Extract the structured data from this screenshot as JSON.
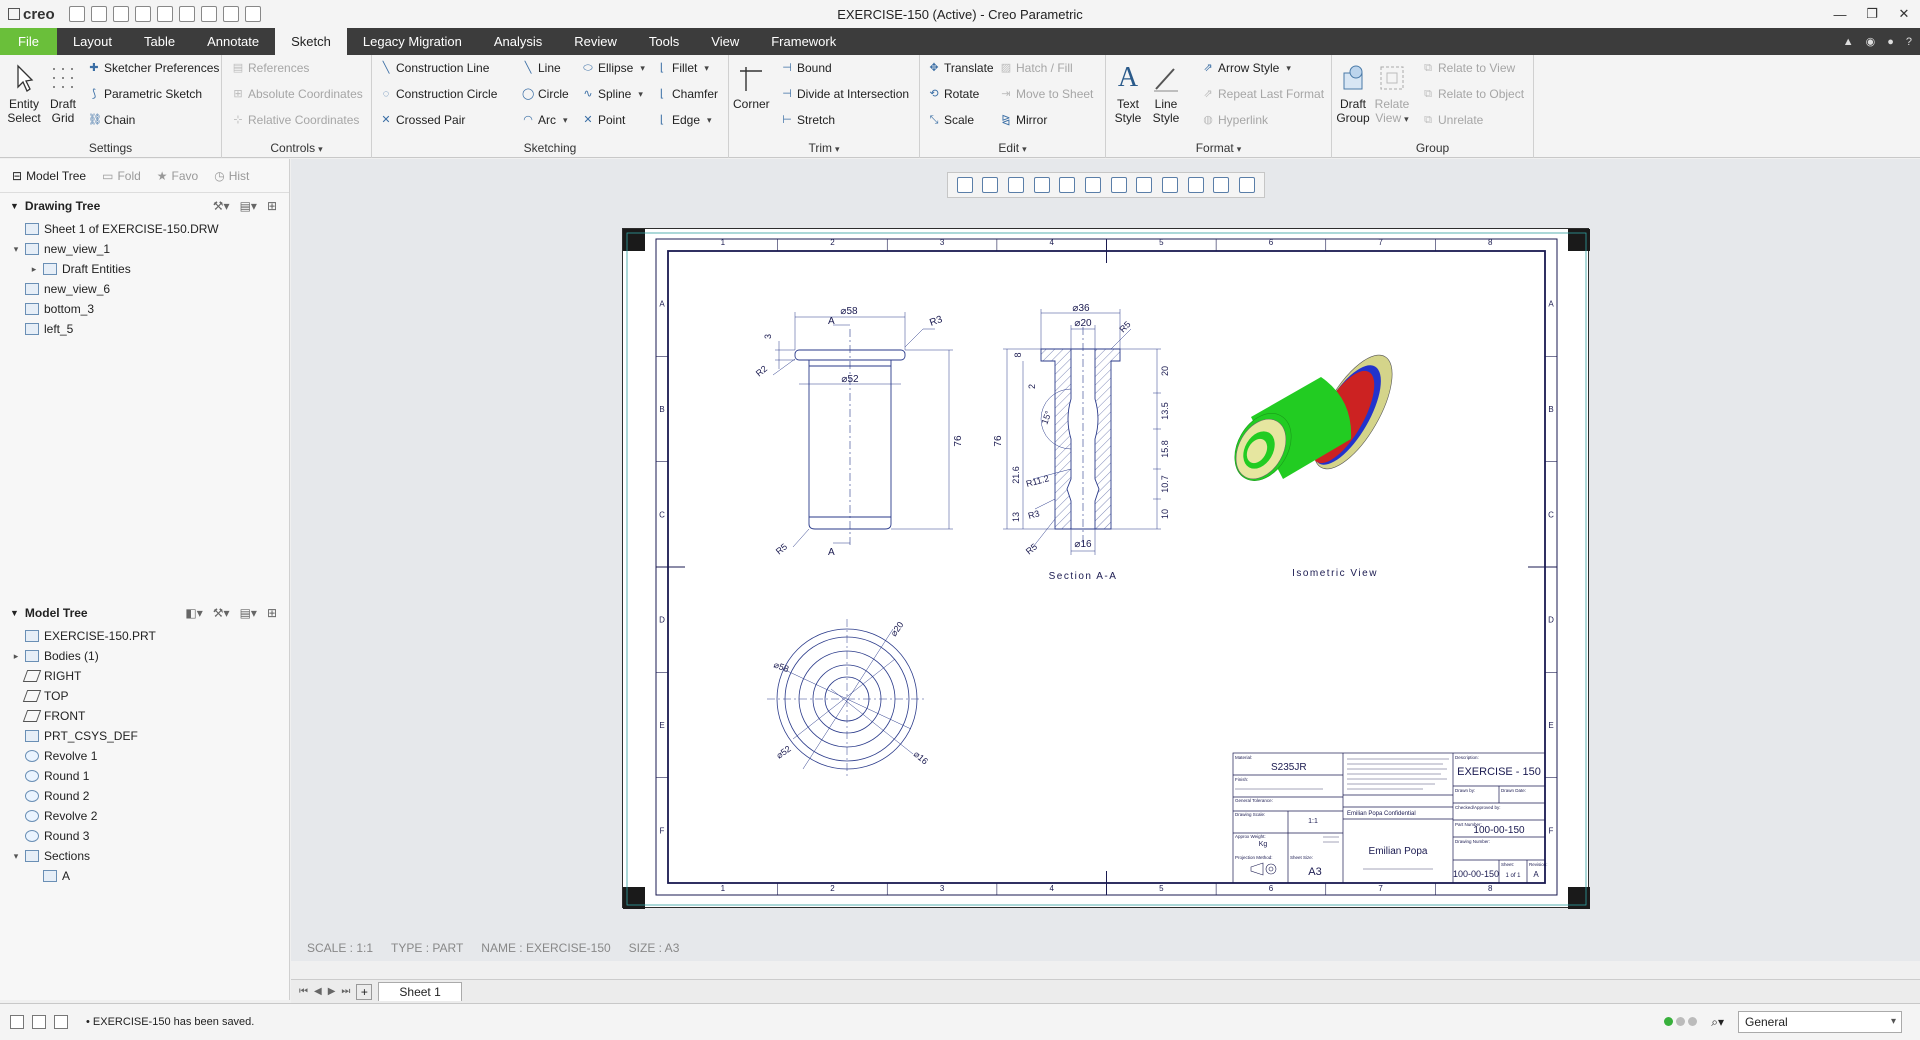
{
  "app": {
    "logo": "creo",
    "title": "EXERCISE-150 (Active) - Creo Parametric"
  },
  "tabs": [
    {
      "label": "File"
    },
    {
      "label": "Layout"
    },
    {
      "label": "Table"
    },
    {
      "label": "Annotate"
    },
    {
      "label": "Sketch"
    },
    {
      "label": "Legacy Migration"
    },
    {
      "label": "Analysis"
    },
    {
      "label": "Review"
    },
    {
      "label": "Tools"
    },
    {
      "label": "View"
    },
    {
      "label": "Framework"
    }
  ],
  "ribbon": {
    "settings": {
      "name": "Settings",
      "entity_select": "Entity Select",
      "draft_grid": "Draft Grid",
      "sketcher_preferences": "Sketcher Preferences",
      "parametric_sketch": "Parametric Sketch",
      "chain": "Chain"
    },
    "controls": {
      "name": "Controls",
      "references": "References",
      "absolute_coordinates": "Absolute Coordinates",
      "relative_coordinates": "Relative Coordinates"
    },
    "sketching": {
      "name": "Sketching",
      "construction_line": "Construction Line",
      "construction_circle": "Construction Circle",
      "crossed_pair": "Crossed Pair",
      "line": "Line",
      "circle": "Circle",
      "arc": "Arc",
      "ellipse": "Ellipse",
      "spline": "Spline",
      "point": "Point",
      "fillet": "Fillet",
      "chamfer": "Chamfer",
      "edge": "Edge"
    },
    "trim": {
      "name": "Trim",
      "corner": "Corner",
      "bound": "Bound",
      "divide_at_intersection": "Divide at Intersection",
      "stretch": "Stretch"
    },
    "edit": {
      "name": "Edit",
      "translate": "Translate",
      "rotate": "Rotate",
      "scale": "Scale",
      "hatch_fill": "Hatch / Fill",
      "move_to_sheet": "Move to Sheet",
      "mirror": "Mirror"
    },
    "format": {
      "name": "Format",
      "text_style": "Text Style",
      "line_style": "Line Style",
      "arrow_style": "Arrow Style",
      "repeat_last_format": "Repeat Last Format",
      "hyperlink": "Hyperlink"
    },
    "group": {
      "name": "Group",
      "draft_group": "Draft Group",
      "relate_view": "Relate View",
      "relate_to_view": "Relate to View",
      "relate_to_object": "Relate to Object",
      "unrelate": "Unrelate"
    }
  },
  "left_panel": {
    "tabs": [
      "Model Tree",
      "Fold",
      "Favo",
      "Hist"
    ],
    "drawing_tree": {
      "title": "Drawing Tree",
      "items": [
        {
          "label": "Sheet 1 of EXERCISE-150.DRW",
          "level": 0,
          "toggle": ""
        },
        {
          "label": "new_view_1",
          "level": 0,
          "toggle": "▾"
        },
        {
          "label": "Draft Entities",
          "level": 1,
          "toggle": "▸"
        },
        {
          "label": "new_view_6",
          "level": 0,
          "toggle": ""
        },
        {
          "label": "bottom_3",
          "level": 0,
          "toggle": ""
        },
        {
          "label": "left_5",
          "level": 0,
          "toggle": ""
        }
      ]
    },
    "model_tree": {
      "title": "Model Tree",
      "items": [
        {
          "label": "EXERCISE-150.PRT",
          "level": 0,
          "toggle": "",
          "kind": "part"
        },
        {
          "label": "Bodies (1)",
          "level": 0,
          "toggle": "▸",
          "kind": "part"
        },
        {
          "label": "RIGHT",
          "level": 0,
          "toggle": "",
          "kind": "plane"
        },
        {
          "label": "TOP",
          "level": 0,
          "toggle": "",
          "kind": "plane"
        },
        {
          "label": "FRONT",
          "level": 0,
          "toggle": "",
          "kind": "plane"
        },
        {
          "label": "PRT_CSYS_DEF",
          "level": 0,
          "toggle": "",
          "kind": "csys"
        },
        {
          "label": "Revolve 1",
          "level": 0,
          "toggle": "",
          "kind": "feat"
        },
        {
          "label": "Round 1",
          "level": 0,
          "toggle": "",
          "kind": "feat"
        },
        {
          "label": "Round 2",
          "level": 0,
          "toggle": "",
          "kind": "feat"
        },
        {
          "label": "Revolve 2",
          "level": 0,
          "toggle": "",
          "kind": "feat"
        },
        {
          "label": "Round 3",
          "level": 0,
          "toggle": "",
          "kind": "feat"
        },
        {
          "label": "Sections",
          "level": 0,
          "toggle": "▾",
          "kind": "part"
        },
        {
          "label": "A",
          "level": 1,
          "toggle": "",
          "kind": "part"
        }
      ]
    }
  },
  "sheet_info": {
    "scale": "SCALE : 1:1",
    "type": "TYPE : PART",
    "name": "NAME : EXERCISE-150",
    "size": "SIZE : A3"
  },
  "drawing": {
    "border_cols": [
      "1",
      "2",
      "3",
      "4",
      "5",
      "6",
      "7",
      "8"
    ],
    "border_rows": [
      "A",
      "B",
      "C",
      "D",
      "E",
      "F"
    ],
    "front_view": {
      "dims": [
        "⌀58",
        "⌀52",
        "R3",
        "R2",
        "R5",
        "3",
        "76"
      ],
      "section_label": "A"
    },
    "section_view": {
      "title": "Section A-A",
      "dims": [
        "⌀36",
        "⌀20",
        "R5",
        "8",
        "2",
        "15°",
        "21.6",
        "R11.2",
        "R3",
        "13",
        "R5",
        "⌀16",
        "20",
        "13.5",
        "15.8",
        "10.7",
        "10",
        "76"
      ]
    },
    "bottom_view": {
      "dims": [
        "⌀58",
        "⌀52",
        "⌀20",
        "⌀16"
      ]
    },
    "iso_view": {
      "title": "Isometric View"
    },
    "title_block": {
      "material_label": "Material:",
      "material": "S235JR",
      "finish_label": "Finish:",
      "tolerance_label": "General Tolerance:",
      "scale_label": "Drawing Scale:",
      "scale": "1:1",
      "weight_label": "Approx Weight:",
      "weight": "Kg",
      "projection_label": "Projection Method:",
      "sheet_size_label": "Sheet Size:",
      "sheet_size": "A3",
      "company": "Emilian Popa Confidential",
      "signature": "Emilian Popa",
      "description_label": "Description:",
      "description": "EXERCISE - 150",
      "drawn_by_label": "Drawn by:",
      "drawn_date_label": "Drawn Date:",
      "checked_label": "Checked/Approved by:",
      "part_number_label": "Part Number:",
      "part_number": "100-00-150",
      "drawing_number_label": "Drawing Number:",
      "drawing_number": "100-00-150",
      "sheet_label": "Sheet:",
      "sheet": "1 of 1",
      "revision_label": "Revision:",
      "revision": "A"
    }
  },
  "sheet_tabs": {
    "add": "+",
    "tabs": [
      "Sheet 1"
    ]
  },
  "status": {
    "message": "EXERCISE-150 has been saved.",
    "filter": "General"
  },
  "colors": {
    "file_tab": "#6abf3a",
    "tab_bar": "#3c3c3c",
    "drawing_line": "#1a1a50",
    "iso_green": "#22cc22",
    "iso_yellow": "#e6e6a0",
    "iso_red": "#cc2222",
    "iso_blue": "#2233cc"
  }
}
